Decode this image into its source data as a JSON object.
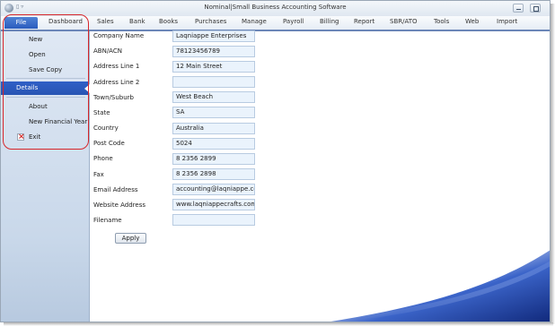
{
  "window": {
    "title": "Nominal|Small Business Accounting Software",
    "qat_symbol": "▯ ▿"
  },
  "ribbon": {
    "tabs": [
      "File",
      "Dashboard",
      "Sales",
      "Bank",
      "Books",
      "Purchases",
      "Manage",
      "Payroll",
      "Billing",
      "Report",
      "SBR/ATO",
      "Tools",
      "Web",
      "Import"
    ]
  },
  "file_menu": {
    "items": [
      "New",
      "Open",
      "Save Copy",
      "Details",
      "About",
      "New Financial Year",
      "Exit"
    ],
    "selected": "Details"
  },
  "form": {
    "fields": [
      {
        "label": "Company Name",
        "value": "Laqniappe Enterprises"
      },
      {
        "label": "ABN/ACN",
        "value": "78123456789"
      },
      {
        "label": "Address Line 1",
        "value": "12 Main Street"
      },
      {
        "label": "Address Line 2",
        "value": ""
      },
      {
        "label": "Town/Suburb",
        "value": "West Beach"
      },
      {
        "label": "State",
        "value": "SA"
      },
      {
        "label": "Country",
        "value": "Australia"
      },
      {
        "label": "Post Code",
        "value": "5024"
      },
      {
        "label": "Phone",
        "value": "8 2356 2899"
      },
      {
        "label": "Fax",
        "value": "8 2356 2898"
      },
      {
        "label": "Email Address",
        "value": "accounting@laqniappe.com"
      },
      {
        "label": "Website Address",
        "value": "www.laqniappecrafts.com"
      },
      {
        "label": "Filename",
        "value": ""
      }
    ],
    "apply_label": "Apply"
  },
  "colors": {
    "accent": "#2f5fc6",
    "highlight_outline": "#d7262a",
    "field_bg": "#eaf3fc"
  }
}
